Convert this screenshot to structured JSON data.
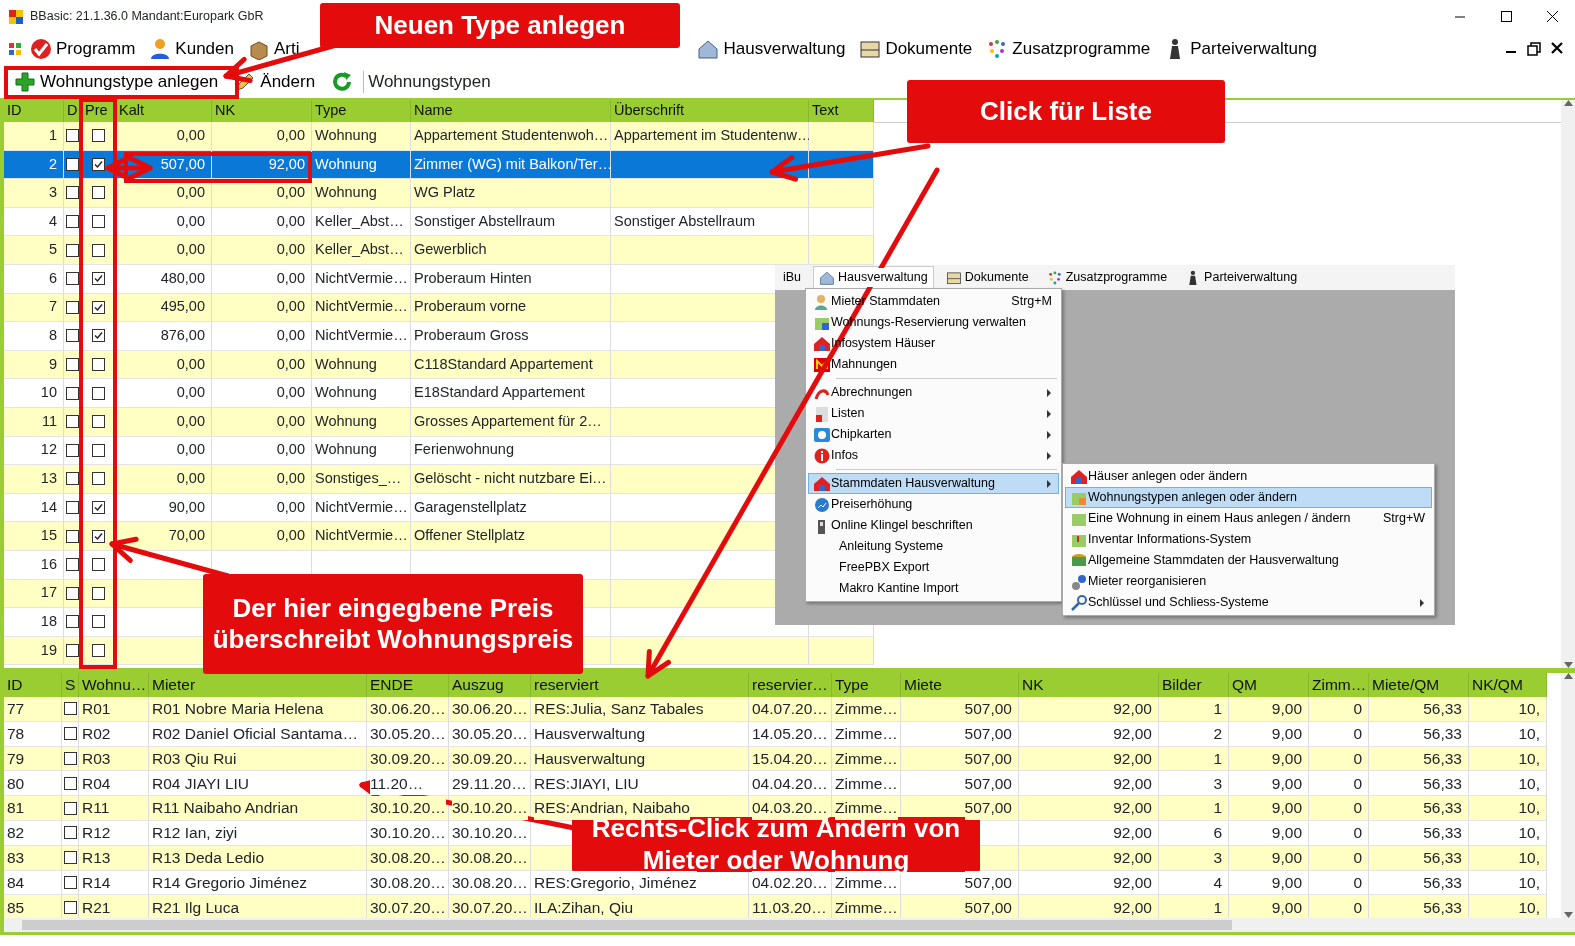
{
  "window": {
    "title": "BBasic: 21.1.36.0 Mandant:Europark GbR"
  },
  "menu": [
    {
      "label": "Programm"
    },
    {
      "label": "Kunden"
    },
    {
      "label": "Arti"
    },
    {
      "label": "Hausverwaltung"
    },
    {
      "label": "Dokumente"
    },
    {
      "label": "Zusatzprogramme"
    },
    {
      "label": "Parteiverwaltung"
    }
  ],
  "toolbar": {
    "buttons": [
      {
        "kind": "add",
        "label": "Wohnungstype anlegen"
      },
      {
        "kind": "edit",
        "label": "Ändern"
      },
      {
        "kind": "refresh"
      }
    ],
    "title": "Wohnungstypen"
  },
  "upper_table": {
    "columns": [
      "ID",
      "D",
      "Pre",
      "Kalt",
      "NK",
      "Type",
      "Name",
      "Überschrift",
      "Text"
    ],
    "rows": [
      {
        "id": "1",
        "d": false,
        "pre": false,
        "kalt": "0,00",
        "nk": "0,00",
        "type": "Wohnung",
        "name": "Appartement Studentenwoh…",
        "ueberschrift": "Appartement im Studentenw…",
        "selected": false
      },
      {
        "id": "2",
        "d": false,
        "pre": true,
        "kalt": "507,00",
        "nk": "92,00",
        "type": "Wohnung",
        "name": "Zimmer (WG) mit Balkon/Ter…",
        "selected": true
      },
      {
        "id": "3",
        "d": false,
        "pre": false,
        "kalt": "0,00",
        "nk": "0,00",
        "type": "Wohnung",
        "name": "WG Platz",
        "selected": false
      },
      {
        "id": "4",
        "d": false,
        "pre": false,
        "kalt": "0,00",
        "nk": "0,00",
        "type": "Keller_Abst…",
        "name": "Sonstiger Abstellraum",
        "ueberschrift": "Sonstiger Abstellraum",
        "selected": false
      },
      {
        "id": "5",
        "d": false,
        "pre": false,
        "kalt": "0,00",
        "nk": "0,00",
        "type": "Keller_Abst…",
        "name": "Gewerblich",
        "selected": false
      },
      {
        "id": "6",
        "d": false,
        "pre": true,
        "kalt": "480,00",
        "nk": "0,00",
        "type": "NichtVermie…",
        "name": "Proberaum Hinten",
        "selected": false
      },
      {
        "id": "7",
        "d": false,
        "pre": true,
        "kalt": "495,00",
        "nk": "0,00",
        "type": "NichtVermie…",
        "name": "Proberaum vorne",
        "selected": false
      },
      {
        "id": "8",
        "d": false,
        "pre": true,
        "kalt": "876,00",
        "nk": "0,00",
        "type": "NichtVermie…",
        "name": "Proberaum Gross",
        "selected": false
      },
      {
        "id": "9",
        "d": false,
        "pre": false,
        "kalt": "0,00",
        "nk": "0,00",
        "type": "Wohnung",
        "name": "C118Standard Appartement",
        "selected": false
      },
      {
        "id": "10",
        "d": false,
        "pre": false,
        "kalt": "0,00",
        "nk": "0,00",
        "type": "Wohnung",
        "name": "E18Standard Appartement",
        "selected": false
      },
      {
        "id": "11",
        "d": false,
        "pre": false,
        "kalt": "0,00",
        "nk": "0,00",
        "type": "Wohnung",
        "name": "Grosses Appartement für 2…",
        "selected": false
      },
      {
        "id": "12",
        "d": false,
        "pre": false,
        "kalt": "0,00",
        "nk": "0,00",
        "type": "Wohnung",
        "name": "Ferienwohnung",
        "selected": false
      },
      {
        "id": "13",
        "d": false,
        "pre": false,
        "kalt": "0,00",
        "nk": "0,00",
        "type": "Sonstiges_…",
        "name": "Gelöscht - nicht nutzbare Ei…",
        "selected": false
      },
      {
        "id": "14",
        "d": false,
        "pre": true,
        "kalt": "90,00",
        "nk": "0,00",
        "type": "NichtVermie…",
        "name": "Garagenstellplatz",
        "selected": false
      },
      {
        "id": "15",
        "d": false,
        "pre": true,
        "kalt": "70,00",
        "nk": "0,00",
        "type": "NichtVermie…",
        "name": "Offener Stellplatz",
        "selected": false
      },
      {
        "id": "16",
        "d": false,
        "pre": false,
        "selected": false
      },
      {
        "id": "17",
        "d": false,
        "pre": false,
        "selected": false
      },
      {
        "id": "18",
        "d": false,
        "pre": false,
        "selected": false
      },
      {
        "id": "19",
        "d": false,
        "pre": false,
        "selected": false
      }
    ]
  },
  "inset": {
    "menubar": [
      {
        "label": "iBu",
        "selected": false
      },
      {
        "label": "Hausverwaltung",
        "selected": true
      },
      {
        "label": "Dokumente",
        "selected": false
      },
      {
        "label": "Zusatzprogramme",
        "selected": false
      },
      {
        "label": "Parteiverwaltung",
        "selected": false
      }
    ],
    "menu": [
      {
        "kind": "item",
        "label": "Mieter Stammdaten",
        "shortcut": "Strg+M",
        "submenu": false,
        "selected": false
      },
      {
        "kind": "item",
        "label": "Wohnungs-Reservierung verwalten",
        "submenu": false,
        "selected": false
      },
      {
        "kind": "item",
        "label": "Infosystem Häuser",
        "submenu": false,
        "selected": false
      },
      {
        "kind": "item",
        "label": "Mahnungen",
        "submenu": false,
        "selected": false
      },
      {
        "kind": "separator"
      },
      {
        "kind": "item",
        "label": "Abrechnungen",
        "submenu": true,
        "selected": false
      },
      {
        "kind": "item",
        "label": "Listen",
        "submenu": true,
        "selected": false
      },
      {
        "kind": "item",
        "label": "Chipkarten",
        "submenu": true,
        "selected": false
      },
      {
        "kind": "item",
        "label": "Infos",
        "submenu": true,
        "selected": false
      },
      {
        "kind": "separator"
      },
      {
        "kind": "item",
        "label": "Stammdaten Hausverwaltung",
        "submenu": true,
        "selected": true
      },
      {
        "kind": "item",
        "label": "Preiserhöhung",
        "submenu": false,
        "selected": false
      },
      {
        "kind": "item",
        "label": "Online Klingel beschriften",
        "submenu": false,
        "selected": false
      },
      {
        "kind": "plain",
        "label": "Anleitung Systeme",
        "submenu": false,
        "selected": false
      },
      {
        "kind": "plain",
        "label": "FreePBX Export",
        "submenu": false,
        "selected": false
      },
      {
        "kind": "plain",
        "label": "Makro Kantine Import",
        "submenu": false,
        "selected": false
      }
    ],
    "submenu": [
      {
        "kind": "item",
        "label": "Häuser anlegen oder ändern",
        "submenu": false,
        "selected": false
      },
      {
        "kind": "item",
        "label": "Wohnungstypen anlegen oder ändern",
        "submenu": false,
        "selected": true
      },
      {
        "kind": "item",
        "label": "Eine Wohnung in einem Haus anlegen / ändern",
        "shortcut": "Strg+W",
        "submenu": false,
        "selected": false
      },
      {
        "kind": "item",
        "label": "Inventar Informations-System",
        "submenu": false,
        "selected": false
      },
      {
        "kind": "item",
        "label": "Allgemeine Stammdaten der Hausverwaltung",
        "submenu": false,
        "selected": false
      },
      {
        "kind": "item",
        "label": "Mieter reorganisieren",
        "submenu": false,
        "selected": false
      },
      {
        "kind": "item",
        "label": "Schlüssel und Schliess-Systeme",
        "submenu": true,
        "selected": false
      }
    ]
  },
  "lower_table": {
    "columns": [
      "ID",
      "S",
      "Wohnu…",
      "Mieter",
      "ENDE",
      "Auszug",
      "reserviert",
      "reservier…",
      "Type",
      "Miete",
      "NK",
      "Bilder",
      "QM",
      "Zimm…",
      "Miete/QM",
      "NK/QM"
    ],
    "rows": [
      {
        "id": "77",
        "s": false,
        "wohnung": "R01",
        "mieter": "R01 Nobre Maria Helena",
        "ende": "30.06.20…",
        "auszug": "30.06.20…",
        "reserviert": "RES:Julia, Sanz Tabales",
        "reserviert_am": "04.07.20…",
        "type": "Zimme…",
        "miete": "507,00",
        "nk": "92,00",
        "bilder": "1",
        "qm": "9,00",
        "zimmer": "0",
        "miete_qm": "56,33",
        "nk_qm": "10,"
      },
      {
        "id": "78",
        "s": false,
        "wohnung": "R02",
        "mieter": "R02 Daniel Oficial Santama…",
        "ende": "30.05.20…",
        "auszug": "30.05.20…",
        "reserviert": "Hausverwaltung",
        "reserviert_am": "14.05.20…",
        "type": "Zimme…",
        "miete": "507,00",
        "nk": "92,00",
        "bilder": "2",
        "qm": "9,00",
        "zimmer": "0",
        "miete_qm": "56,33",
        "nk_qm": "10,"
      },
      {
        "id": "79",
        "s": false,
        "wohnung": "R03",
        "mieter": "R03 Qiu Rui",
        "ende": "30.09.20…",
        "auszug": "30.09.20…",
        "reserviert": "Hausverwaltung",
        "reserviert_am": "15.04.20…",
        "type": "Zimme…",
        "miete": "507,00",
        "nk": "92,00",
        "bilder": "1",
        "qm": "9,00",
        "zimmer": "0",
        "miete_qm": "56,33",
        "nk_qm": "10,"
      },
      {
        "id": "80",
        "s": false,
        "wohnung": "R04",
        "mieter": "R04 JIAYI LIU",
        "ende": "11.20…",
        "auszug": "29.11.20…",
        "reserviert": "RES:JIAYI, LIU",
        "reserviert_am": "04.04.20…",
        "type": "Zimme…",
        "miete": "507,00",
        "nk": "92,00",
        "bilder": "3",
        "qm": "9,00",
        "zimmer": "0",
        "miete_qm": "56,33",
        "nk_qm": "10,"
      },
      {
        "id": "81",
        "s": false,
        "wohnung": "R11",
        "mieter": "R11 Naibaho Andrian",
        "ende": "30.10.20…",
        "auszug": "30.10.20…",
        "reserviert": "RES:Andrian, Naibaho",
        "reserviert_am": "04.03.20…",
        "type": "Zimme…",
        "miete": "507,00",
        "nk": "92,00",
        "bilder": "1",
        "qm": "9,00",
        "zimmer": "0",
        "miete_qm": "56,33",
        "nk_qm": "10,"
      },
      {
        "id": "82",
        "s": false,
        "wohnung": "R12",
        "mieter": "R12 Ian, ziyi",
        "ende": "30.10.20…",
        "auszug": "30.10.20…",
        "nk": "92,00",
        "bilder": "6",
        "qm": "9,00",
        "zimmer": "0",
        "miete_qm": "56,33",
        "nk_qm": "10,"
      },
      {
        "id": "83",
        "s": false,
        "wohnung": "R13",
        "mieter": "R13 Deda Ledio",
        "ende": "30.08.20…",
        "auszug": "30.08.20…",
        "nk": "92,00",
        "bilder": "3",
        "qm": "9,00",
        "zimmer": "0",
        "miete_qm": "56,33",
        "nk_qm": "10,"
      },
      {
        "id": "84",
        "s": false,
        "wohnung": "R14",
        "mieter": "R14 Gregorio Jiménez",
        "ende": "30.08.20…",
        "auszug": "30.08.20…",
        "reserviert": "RES:Gregorio, Jiménez",
        "reserviert_am": "04.02.20…",
        "type": "Zimme…",
        "miete": "507,00",
        "nk": "92,00",
        "bilder": "4",
        "qm": "9,00",
        "zimmer": "0",
        "miete_qm": "56,33",
        "nk_qm": "10,"
      },
      {
        "id": "85",
        "s": false,
        "wohnung": "R21",
        "mieter": "R21 Ilg Luca",
        "ende": "30.07.20…",
        "auszug": "30.07.20…",
        "reserviert": "ILA:Zihan, Qiu",
        "reserviert_am": "11.03.20…",
        "type": "Zimme…",
        "miete": "507,00",
        "nk": "92,00",
        "bilder": "1",
        "qm": "9,00",
        "zimmer": "0",
        "miete_qm": "56,33",
        "nk_qm": "10,"
      }
    ]
  },
  "callouts": [
    {
      "text": "Neuen Type anlegen"
    },
    {
      "text": "Click für Liste"
    },
    {
      "text": "Der hier eingegbene Preis überschreibt Wohnungspreis"
    },
    {
      "text": "Rechts-Click zum Ändern von Mieter oder Wohnung"
    }
  ]
}
